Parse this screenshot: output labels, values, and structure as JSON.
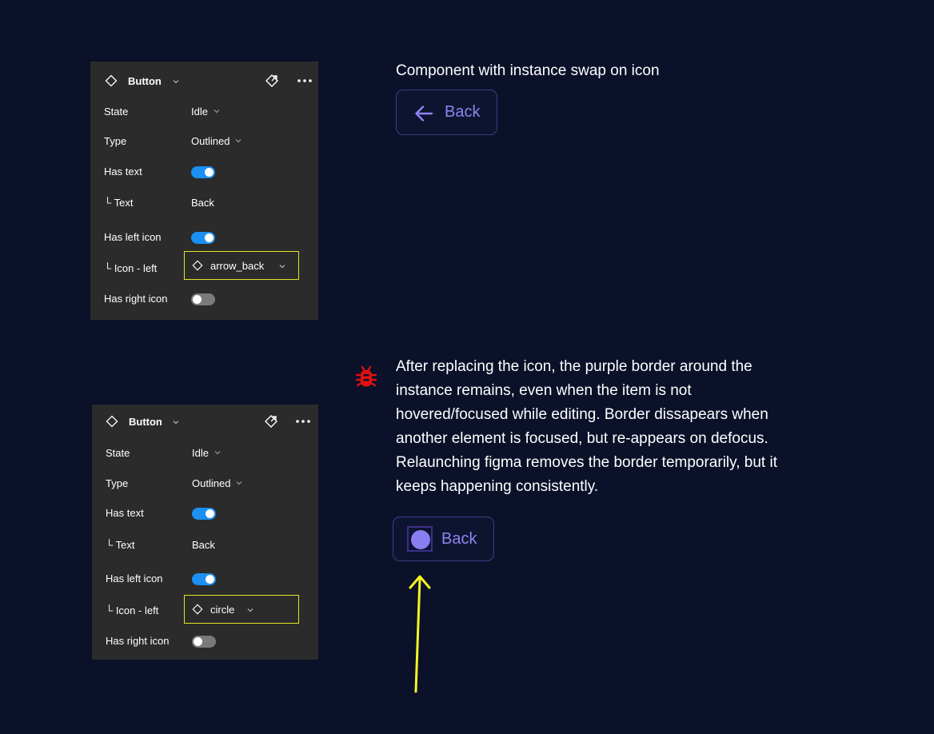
{
  "panels": [
    {
      "title": "Button",
      "rows": {
        "state": {
          "label": "State",
          "value": "Idle"
        },
        "type": {
          "label": "Type",
          "value": "Outlined"
        },
        "has_text": {
          "label": "Has text",
          "on": true
        },
        "text": {
          "label": "└ Text",
          "value": "Back"
        },
        "has_left_icon": {
          "label": "Has left icon",
          "on": true
        },
        "icon_left": {
          "label": "└ Icon - left",
          "value": "arrow_back"
        },
        "has_right_icon": {
          "label": "Has right icon",
          "on": false
        }
      }
    },
    {
      "title": "Button",
      "rows": {
        "state": {
          "label": "State",
          "value": "Idle"
        },
        "type": {
          "label": "Type",
          "value": "Outlined"
        },
        "has_text": {
          "label": "Has text",
          "on": true
        },
        "text": {
          "label": "└ Text",
          "value": "Back"
        },
        "has_left_icon": {
          "label": "Has left icon",
          "on": true
        },
        "icon_left": {
          "label": "└ Icon - left",
          "value": "circle"
        },
        "has_right_icon": {
          "label": "Has right icon",
          "on": false
        }
      }
    }
  ],
  "caption": "Component with instance swap on icon",
  "button_1": {
    "label": "Back",
    "icon": "arrow-back-icon"
  },
  "bug": {
    "icon": "bug-icon",
    "text": "After replacing the icon, the purple border around the instance remains, even when the item is not hovered/focused while editing. Border dissapears when another element is focused, but re-appears on defocus. Relaunching figma removes the border temporarily, but it keeps happening consistently."
  },
  "button_2": {
    "label": "Back",
    "icon": "circle-icon"
  },
  "colors": {
    "background": "#0b1129",
    "panel": "#2b2b2b",
    "toggle_on": "#1b8ff2",
    "highlight": "#e3e327",
    "button_text": "#8f83f0",
    "bug": "#e01010",
    "annotation_arrow": "#f5f523"
  }
}
